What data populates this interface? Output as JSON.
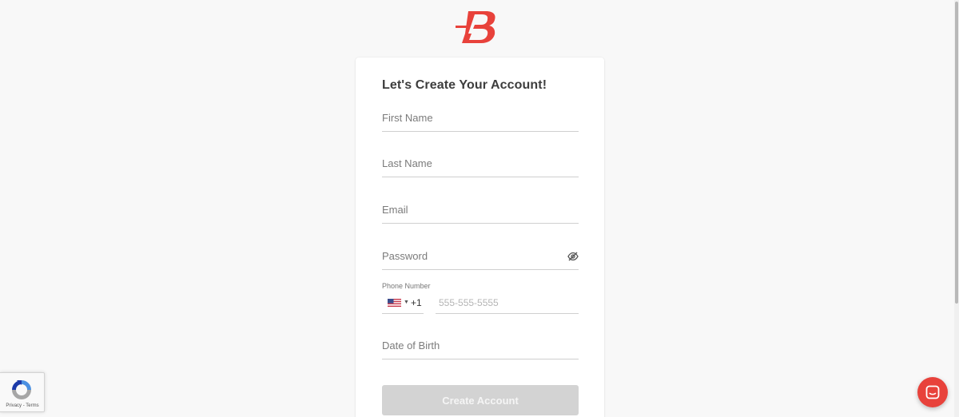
{
  "brand": {
    "logo_icon": "brand-b-logo",
    "accent_color": "#e8423b"
  },
  "form": {
    "title": "Let's Create Your Account!",
    "first_name": {
      "placeholder": "First Name",
      "value": ""
    },
    "last_name": {
      "placeholder": "Last Name",
      "value": ""
    },
    "email": {
      "placeholder": "Email",
      "value": ""
    },
    "password": {
      "placeholder": "Password",
      "value": "",
      "toggle_icon": "eye-off-icon"
    },
    "phone": {
      "label": "Phone Number",
      "country_flag": "us-flag-icon",
      "dial_code": "+1",
      "placeholder": "555-555-5555",
      "value": ""
    },
    "dob": {
      "placeholder": "Date of Birth",
      "value": ""
    },
    "submit_label": "Create Account",
    "submit_disabled_color": "#d3d3d3"
  },
  "recaptcha": {
    "privacy": "Privacy",
    "separator": " - ",
    "terms": "Terms"
  },
  "chat": {
    "icon": "chat-icon"
  }
}
